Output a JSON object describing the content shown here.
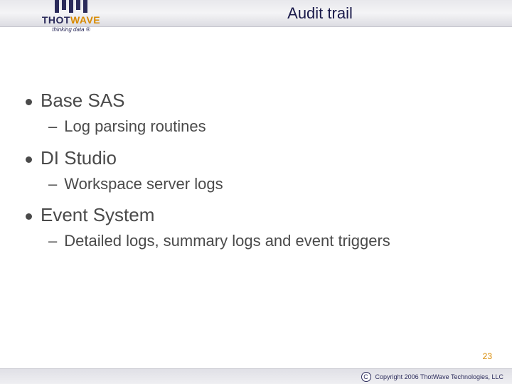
{
  "header": {
    "title": "Audit trail",
    "logo": {
      "brand_part1": "THOT",
      "brand_part2": "WAVE",
      "tagline": "thinking data ®"
    }
  },
  "bullets": [
    {
      "text": "Base SAS",
      "sub": [
        {
          "text": "Log parsing routines"
        }
      ]
    },
    {
      "text": "DI Studio",
      "sub": [
        {
          "text": "Workspace server logs"
        }
      ]
    },
    {
      "text": "Event System",
      "sub": [
        {
          "text": "Detailed logs, summary logs and event triggers"
        }
      ]
    }
  ],
  "page_number": "23",
  "footer": {
    "copyright_symbol": "C",
    "text": "Copyright 2006 ThotWave Technologies, LLC"
  }
}
